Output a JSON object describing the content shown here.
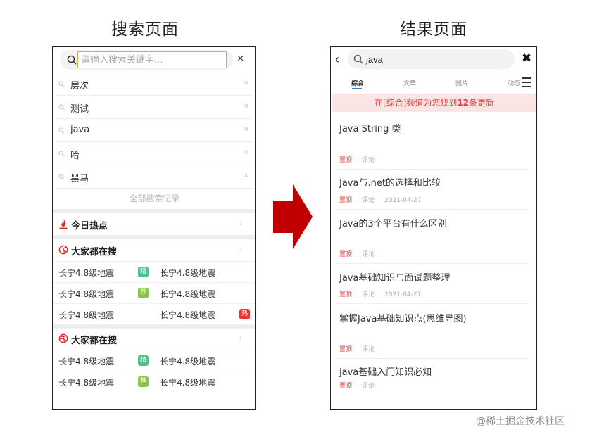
{
  "titles": {
    "left": "搜索页面",
    "right": "结果页面"
  },
  "search_page": {
    "placeholder": "请输入搜索关键字...",
    "close": "×",
    "history": [
      "层次",
      "测试",
      "java",
      "哈",
      "黑马"
    ],
    "history_delete": "×",
    "all_history": "全部搜索记录",
    "today_hot": {
      "title": "今日热点",
      "chevron": "›"
    },
    "everyone_search_1": {
      "title": "大家都在搜",
      "chevron": "›",
      "rows": [
        {
          "left": "长宁4.8级地震",
          "left_tag": "精",
          "right": "长宁4.8级地震",
          "right_tag": ""
        },
        {
          "left": "长宁4.8级地震",
          "left_tag": "荐",
          "right": "长宁4.8级地震",
          "right_tag": ""
        },
        {
          "left": "长宁4.8级地震",
          "left_tag": "",
          "right": "长宁4.8级地震",
          "right_tag": "热"
        }
      ]
    },
    "everyone_search_2": {
      "title": "大家都在搜",
      "chevron": "›",
      "rows": [
        {
          "left": "长宁4.8级地震",
          "left_tag": "精",
          "right": "长宁4.8级地震",
          "right_tag": ""
        },
        {
          "left": "长宁4.8级地震",
          "left_tag": "荐",
          "right": "长宁4.8级地震",
          "right_tag": ""
        }
      ]
    },
    "tag_colors": {
      "精": "#4cc38a",
      "荐": "#8bc34a",
      "热": "#e53935"
    }
  },
  "result_page": {
    "back": "‹",
    "query": "java",
    "close": "✖",
    "tabs": [
      "综合",
      "文章",
      "图片",
      "动态"
    ],
    "banner": {
      "prefix": "在[综合]频道为您找到",
      "count": "12",
      "suffix": "条更新"
    },
    "articles": [
      {
        "title": "Java String 类",
        "pin": "置顶",
        "comment": "评论",
        "date": ""
      },
      {
        "title": "Java与.net的选择和比较",
        "pin": "置顶",
        "comment": "评论",
        "date": "2021-04-27"
      },
      {
        "title": "Java的3个平台有什么区别",
        "pin": "置顶",
        "comment": "评论",
        "date": ""
      },
      {
        "title": "Java基础知识与面试题整理",
        "pin": "置顶",
        "comment": "评论",
        "date": "2021-04-27"
      },
      {
        "title": "掌握Java基础知识点(思维导图)",
        "pin": "置顶",
        "comment": "评论",
        "date": ""
      },
      {
        "title": "java基础入门知识必知",
        "pin": "置顶",
        "comment": "评论",
        "date": ""
      }
    ]
  },
  "watermark": "@稀土掘金技术社区",
  "colors": {
    "arrow": "#c00000",
    "accent_red": "#e53935",
    "tab_underline": "#3b7bd6"
  }
}
